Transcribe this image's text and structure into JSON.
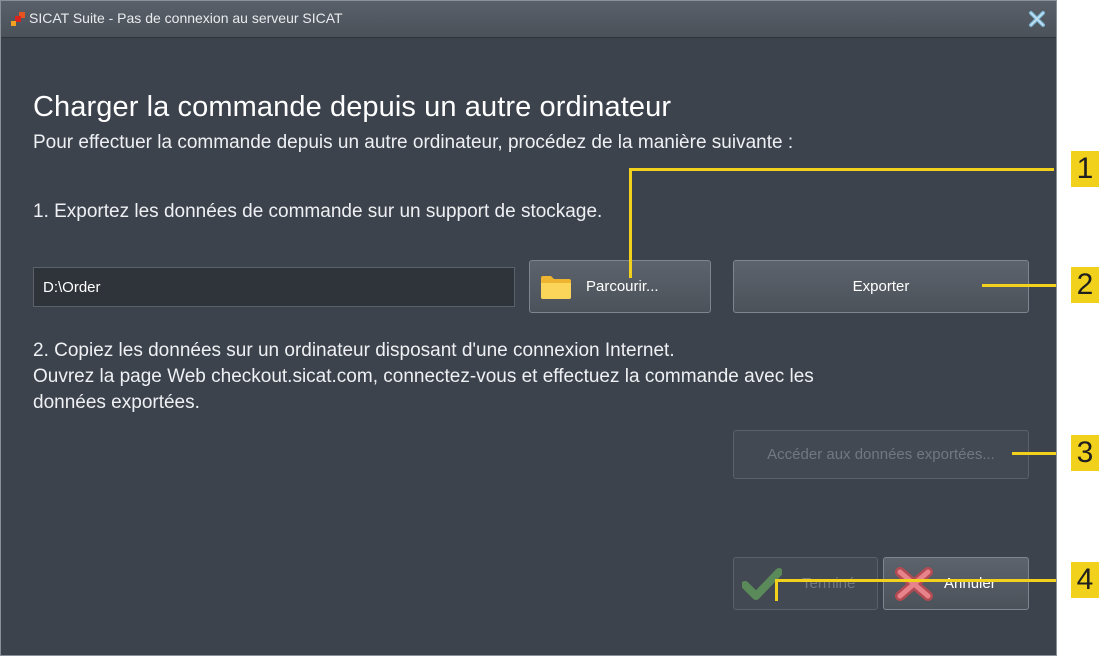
{
  "window": {
    "title": "SICAT Suite - Pas de connexion au serveur SICAT",
    "accent_color": "#f2d11c",
    "background_color": "#3d434d"
  },
  "main": {
    "heading": "Charger la commande depuis un autre ordinateur",
    "intro": "Pour effectuer la commande depuis un autre ordinateur, procédez de la manière suivante :",
    "step1": "1. Exportez les données de commande sur un support de stockage.",
    "path_value": "D:\\Order",
    "browse_label": "Parcourir...",
    "export_label": "Exporter",
    "step2_line1": "2. Copiez les données sur un ordinateur disposant d'une connexion Internet.",
    "step2_line2": "Ouvrez la page Web checkout.sicat.com, connectez-vous et effectuez la commande avec les",
    "step2_line3": "données exportées.",
    "access_label": "Accéder aux données exportées...",
    "done_label": "Terminé",
    "cancel_label": "Annuler"
  },
  "callouts": [
    "1",
    "2",
    "3",
    "4"
  ],
  "icons": {
    "app": "sicat-logo-icon",
    "close": "close-icon",
    "browse": "folder-icon",
    "done": "checkmark-icon",
    "cancel": "cross-icon"
  }
}
